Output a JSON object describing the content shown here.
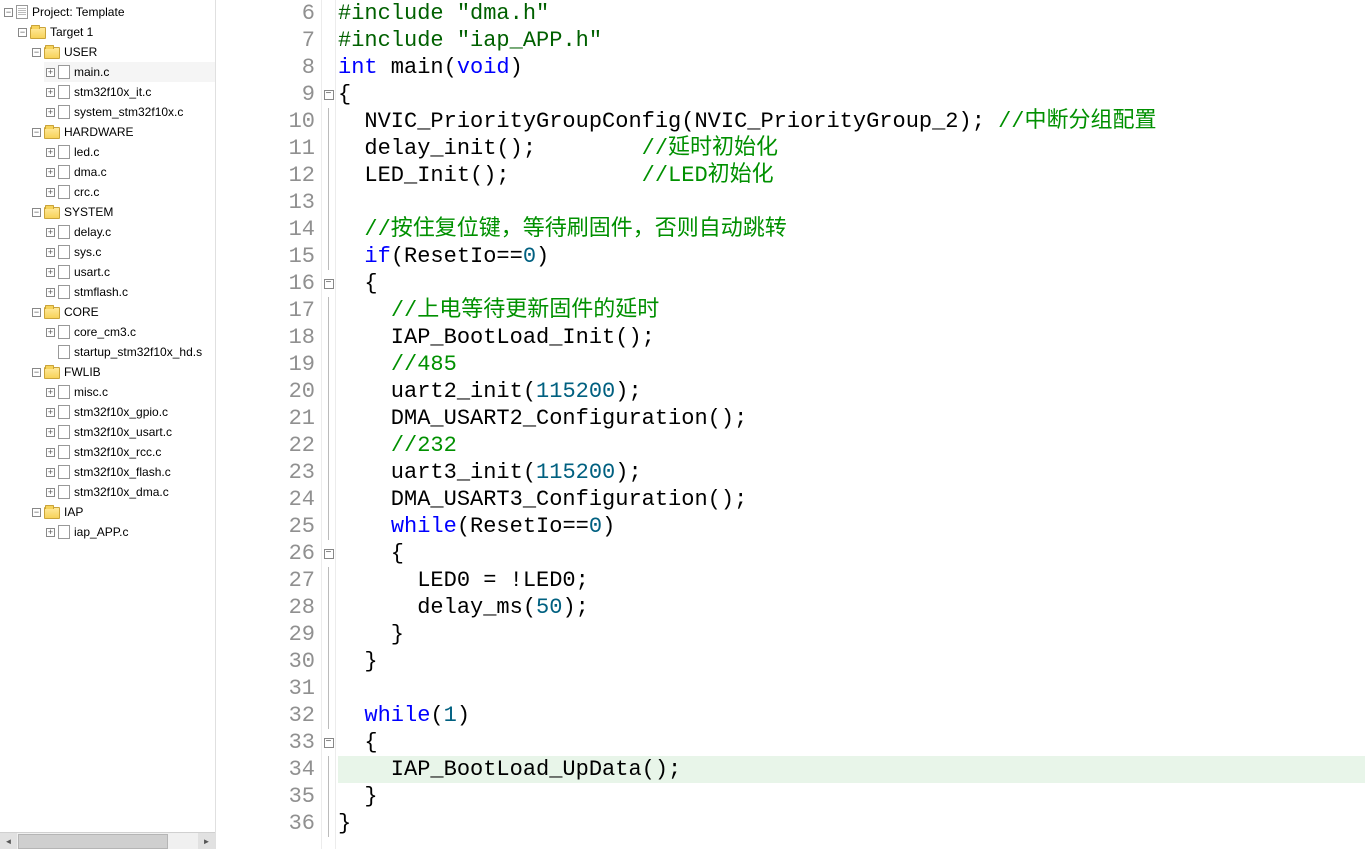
{
  "project": {
    "root": "Project: Template",
    "target": "Target 1",
    "groups": [
      {
        "name": "USER",
        "files": [
          "main.c",
          "stm32f10x_it.c",
          "system_stm32f10x.c"
        ]
      },
      {
        "name": "HARDWARE",
        "files": [
          "led.c",
          "dma.c",
          "crc.c"
        ]
      },
      {
        "name": "SYSTEM",
        "files": [
          "delay.c",
          "sys.c",
          "usart.c",
          "stmflash.c"
        ]
      },
      {
        "name": "CORE",
        "files": [
          "core_cm3.c",
          "startup_stm32f10x_hd.s"
        ]
      },
      {
        "name": "FWLIB",
        "files": [
          "misc.c",
          "stm32f10x_gpio.c",
          "stm32f10x_usart.c",
          "stm32f10x_rcc.c",
          "stm32f10x_flash.c",
          "stm32f10x_dma.c"
        ]
      },
      {
        "name": "IAP",
        "files": [
          "iap_APP.c"
        ]
      }
    ],
    "selected_file": "main.c"
  },
  "editor": {
    "first_line": 6,
    "highlight_line": 34,
    "lines": [
      {
        "n": 6,
        "fold": "",
        "tokens": [
          [
            "pp",
            "#include "
          ],
          [
            "str",
            "\"dma.h\""
          ]
        ]
      },
      {
        "n": 7,
        "fold": "",
        "tokens": [
          [
            "pp",
            "#include "
          ],
          [
            "str",
            "\"iap_APP.h\""
          ]
        ]
      },
      {
        "n": 8,
        "fold": "",
        "tokens": [
          [
            "ty",
            "int"
          ],
          [
            "",
            " main("
          ],
          [
            "ty",
            "void"
          ],
          [
            "",
            ")"
          ]
        ]
      },
      {
        "n": 9,
        "fold": "-",
        "tokens": [
          [
            "",
            "{"
          ]
        ]
      },
      {
        "n": 10,
        "fold": "|",
        "tokens": [
          [
            "",
            "  NVIC_PriorityGroupConfig(NVIC_PriorityGroup_2); "
          ],
          [
            "cmt",
            "//中断分组配置"
          ]
        ]
      },
      {
        "n": 11,
        "fold": "|",
        "tokens": [
          [
            "",
            "  delay_init();        "
          ],
          [
            "cmt",
            "//延时初始化"
          ]
        ]
      },
      {
        "n": 12,
        "fold": "|",
        "tokens": [
          [
            "",
            "  LED_Init();          "
          ],
          [
            "cmt",
            "//LED初始化"
          ]
        ]
      },
      {
        "n": 13,
        "fold": "|",
        "tokens": [
          [
            "",
            ""
          ]
        ]
      },
      {
        "n": 14,
        "fold": "|",
        "tokens": [
          [
            "",
            "  "
          ],
          [
            "cmt",
            "//按住复位键，等待刷固件，否则自动跳转"
          ]
        ]
      },
      {
        "n": 15,
        "fold": "|",
        "tokens": [
          [
            "",
            "  "
          ],
          [
            "kw",
            "if"
          ],
          [
            "",
            "(ResetIo=="
          ],
          [
            "num",
            "0"
          ],
          [
            "",
            ")"
          ]
        ]
      },
      {
        "n": 16,
        "fold": "-",
        "tokens": [
          [
            "",
            "  {"
          ]
        ]
      },
      {
        "n": 17,
        "fold": "|",
        "tokens": [
          [
            "",
            "    "
          ],
          [
            "cmt",
            "//上电等待更新固件的延时"
          ]
        ]
      },
      {
        "n": 18,
        "fold": "|",
        "tokens": [
          [
            "",
            "    IAP_BootLoad_Init();"
          ]
        ]
      },
      {
        "n": 19,
        "fold": "|",
        "tokens": [
          [
            "",
            "    "
          ],
          [
            "cmt",
            "//485"
          ]
        ]
      },
      {
        "n": 20,
        "fold": "|",
        "tokens": [
          [
            "",
            "    uart2_init("
          ],
          [
            "num",
            "115200"
          ],
          [
            "",
            ");"
          ]
        ]
      },
      {
        "n": 21,
        "fold": "|",
        "tokens": [
          [
            "",
            "    DMA_USART2_Configuration();"
          ]
        ]
      },
      {
        "n": 22,
        "fold": "|",
        "tokens": [
          [
            "",
            "    "
          ],
          [
            "cmt",
            "//232"
          ]
        ]
      },
      {
        "n": 23,
        "fold": "|",
        "tokens": [
          [
            "",
            "    uart3_init("
          ],
          [
            "num",
            "115200"
          ],
          [
            "",
            ");"
          ]
        ]
      },
      {
        "n": 24,
        "fold": "|",
        "tokens": [
          [
            "",
            "    DMA_USART3_Configuration();"
          ]
        ]
      },
      {
        "n": 25,
        "fold": "|",
        "tokens": [
          [
            "",
            "    "
          ],
          [
            "kw",
            "while"
          ],
          [
            "",
            "(ResetIo=="
          ],
          [
            "num",
            "0"
          ],
          [
            "",
            ")"
          ]
        ]
      },
      {
        "n": 26,
        "fold": "-",
        "tokens": [
          [
            "",
            "    {"
          ]
        ]
      },
      {
        "n": 27,
        "fold": "|",
        "tokens": [
          [
            "",
            "      LED0 = !LED0;"
          ]
        ]
      },
      {
        "n": 28,
        "fold": "|",
        "tokens": [
          [
            "",
            "      delay_ms("
          ],
          [
            "num",
            "50"
          ],
          [
            "",
            ");"
          ]
        ]
      },
      {
        "n": 29,
        "fold": "|",
        "tokens": [
          [
            "",
            "    }"
          ]
        ]
      },
      {
        "n": 30,
        "fold": "|",
        "tokens": [
          [
            "",
            "  }"
          ]
        ]
      },
      {
        "n": 31,
        "fold": "|",
        "tokens": [
          [
            "",
            ""
          ]
        ]
      },
      {
        "n": 32,
        "fold": "|",
        "tokens": [
          [
            "",
            "  "
          ],
          [
            "kw",
            "while"
          ],
          [
            "",
            "("
          ],
          [
            "num",
            "1"
          ],
          [
            "",
            ")"
          ]
        ]
      },
      {
        "n": 33,
        "fold": "-",
        "tokens": [
          [
            "",
            "  {"
          ]
        ]
      },
      {
        "n": 34,
        "fold": "|",
        "tokens": [
          [
            "",
            "    IAP_BootLoad_UpData();"
          ]
        ]
      },
      {
        "n": 35,
        "fold": "|",
        "tokens": [
          [
            "",
            "  }"
          ]
        ]
      },
      {
        "n": 36,
        "fold": "|",
        "tokens": [
          [
            "",
            "}"
          ]
        ]
      }
    ]
  }
}
